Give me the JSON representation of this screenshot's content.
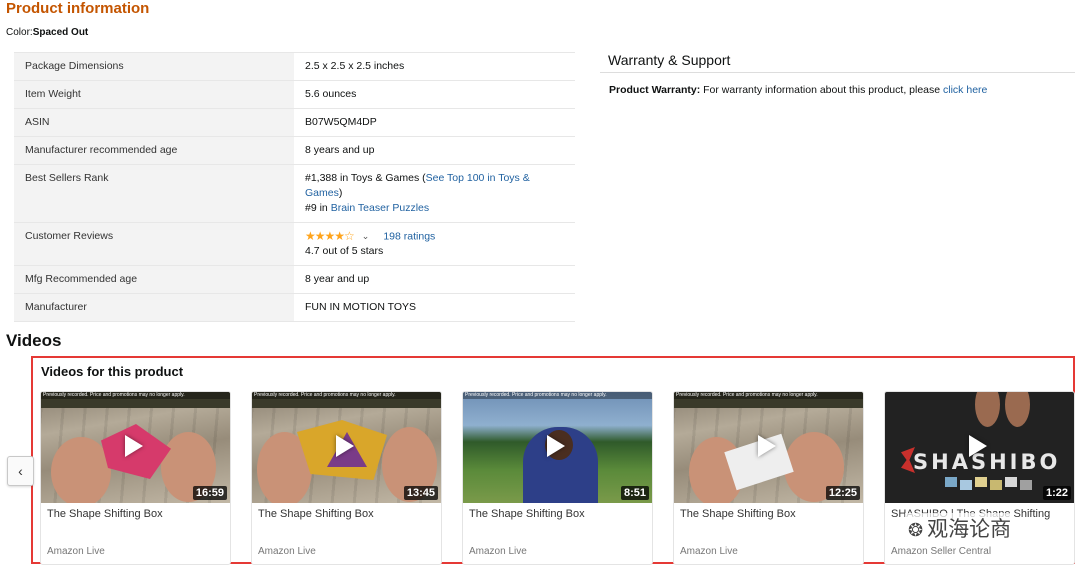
{
  "product_info": {
    "title": "Product information",
    "color_label": "Color:",
    "color_value": "Spaced Out"
  },
  "details": {
    "package_dimensions": {
      "label": "Package Dimensions",
      "value": "2.5 x 2.5 x 2.5 inches"
    },
    "item_weight": {
      "label": "Item Weight",
      "value": "5.6 ounces"
    },
    "asin": {
      "label": "ASIN",
      "value": "B07W5QM4DP"
    },
    "recommended_age": {
      "label": "Manufacturer recommended age",
      "value": "8 years and up"
    },
    "best_sellers_rank": {
      "label": "Best Sellers Rank",
      "rank1_text": "#1,388 in Toys & Games (",
      "rank1_link": "See Top 100 in Toys & Games",
      "rank1_close": ")",
      "rank2_text": "#9 in ",
      "rank2_link": "Brain Teaser Puzzles"
    },
    "customer_reviews": {
      "label": "Customer Reviews",
      "stars": "★★★★☆",
      "chevron": "⌄",
      "ratings_link": "198 ratings",
      "rating_text": "4.7 out of 5 stars",
      "rating_value": 4.7
    },
    "mfg_age": {
      "label": "Mfg Recommended age",
      "value": "8 year and up"
    },
    "manufacturer": {
      "label": "Manufacturer",
      "value": "FUN IN MOTION TOYS"
    }
  },
  "warranty": {
    "title": "Warranty & Support",
    "label": "Product Warranty:",
    "text": " For warranty information about this product, please ",
    "link": "click here"
  },
  "videos": {
    "heading": "Videos",
    "subheading": "Videos for this product",
    "prev_icon": "‹",
    "banner_text": "Previously recorded. Price and promotions may no longer apply.",
    "cards": [
      {
        "title": "The Shape Shifting Box",
        "source": "Amazon Live",
        "duration": "16:59"
      },
      {
        "title": "The Shape Shifting Box",
        "source": "Amazon Live",
        "duration": "13:45"
      },
      {
        "title": "The Shape Shifting Box",
        "source": "Amazon Live",
        "duration": "8:51"
      },
      {
        "title": "The Shape Shifting Box",
        "source": "Amazon Live",
        "duration": "12:25"
      },
      {
        "title": "SHASHIBO | The Shape Shifting",
        "source": "Amazon Seller Central",
        "duration": "1:22",
        "thumb_text": "SHASHIBO"
      }
    ]
  },
  "watermark": {
    "text": "观海论商",
    "icon": "wechat-icon"
  },
  "colors": {
    "section_title": "#c45500",
    "link": "#2162a1",
    "stars": "#ffa41c",
    "highlight_border": "#e53935"
  }
}
